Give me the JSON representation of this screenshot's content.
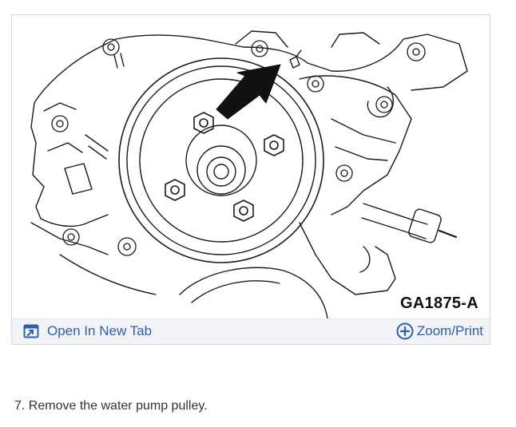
{
  "figure": {
    "id_label": "GA1875-A"
  },
  "actions": {
    "open_new_tab_label": "Open In New Tab",
    "zoom_print_label": "Zoom/Print",
    "open_new_tab_icon": "open-in-new-tab-icon",
    "zoom_print_icon": "plus-circle-icon",
    "link_color": "#2f5fa7"
  },
  "instruction": {
    "step_text": "7. Remove the water pump pulley."
  }
}
